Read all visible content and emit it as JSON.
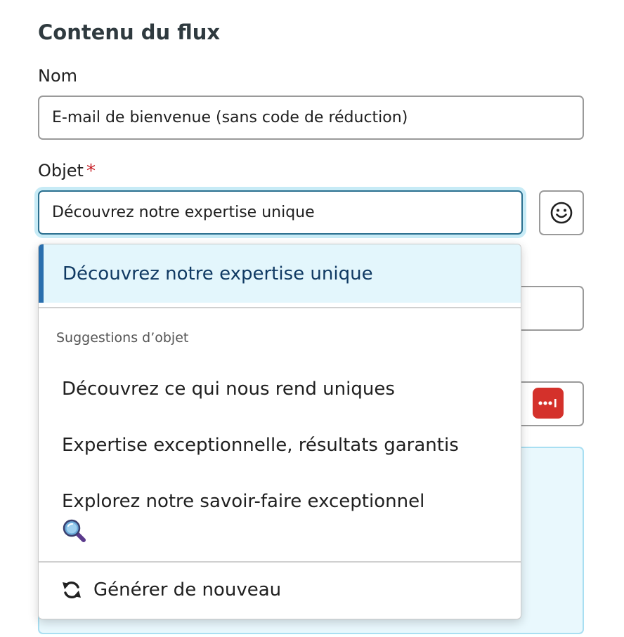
{
  "section": {
    "title": "Contenu du flux"
  },
  "name_field": {
    "label": "Nom",
    "value": "E-mail de bienvenue (sans code de réduction)"
  },
  "subject_field": {
    "label": "Objet",
    "required_mark": "*",
    "value": "Découvrez notre expertise unique"
  },
  "icons": {
    "emoji": "smiley-icon",
    "merge_tag": "merge-tag-icon",
    "suggestion_emoji": "magnifying-glass-icon",
    "regenerate": "refresh-icon"
  },
  "dropdown": {
    "current_option": "Découvrez notre expertise unique",
    "group_heading": "Suggestions d’objet",
    "suggestions": [
      "Découvrez ce qui nous rend uniques",
      "Expertise exceptionnelle, résultats garantis",
      "Explorez notre savoir-faire exceptionnel"
    ],
    "regenerate_label": "Générer de nouveau"
  },
  "colors": {
    "accent": "#2a6fae",
    "focus_ring": "#c7ebf6",
    "required": "#c81d25",
    "merge_tag_bg": "#d4312b",
    "highlight_bg": "#e3f6fc"
  }
}
